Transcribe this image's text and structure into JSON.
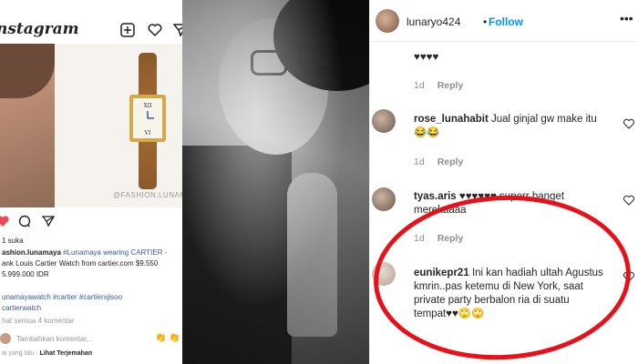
{
  "left_panel": {
    "logo": "nstagram",
    "likes": "1 suka",
    "caption_line1_user": "ashion.lunamaya",
    "caption_line1_rest": "#Lunamaya wearing CARTIER -",
    "caption_line2": "ank Louis Cartier Watch from cartier.com $9.550",
    "caption_line3": "5.999.000 IDR",
    "hashtags_line1": "unamayawatch #cartier #cartierxjisoo",
    "hashtags_line2": "cartierwatch",
    "view_all": "hat semua 4 komentar",
    "add_comment": "Tambahkan komentar...",
    "translation_prefix": "ai yang lalu ·",
    "translation_link": "Lihat Terjemahan",
    "watermark": "@FASHION.LUNAMAYA"
  },
  "right_panel": {
    "header": {
      "username": "lunaryo424",
      "separator": "•",
      "follow_label": "Follow",
      "more_icon": "more-icon"
    },
    "comments": [
      {
        "username": "",
        "text": "♥♥♥♥",
        "age": "1d",
        "reply": "Reply"
      },
      {
        "username": "rose_lunahabit",
        "text": "Jual ginjal gw make itu 😂😂",
        "age": "1d",
        "reply": "Reply"
      },
      {
        "username": "tyas.aris",
        "text": "♥♥♥♥♥♥ superr banget merekaaaa",
        "age": "1d",
        "reply": "Reply"
      },
      {
        "username": "eunikepr21",
        "text": "Ini kan hadiah ultah Agustus kmrin..pas ketemu di New York, saat private party berbalon ria di suatu tempat♥♥🙄🙄",
        "age": "",
        "reply": ""
      }
    ]
  },
  "colors": {
    "follow": "#0095f6",
    "highlight_ellipse": "#e8111a",
    "meta_gray": "#8e8e8e"
  }
}
